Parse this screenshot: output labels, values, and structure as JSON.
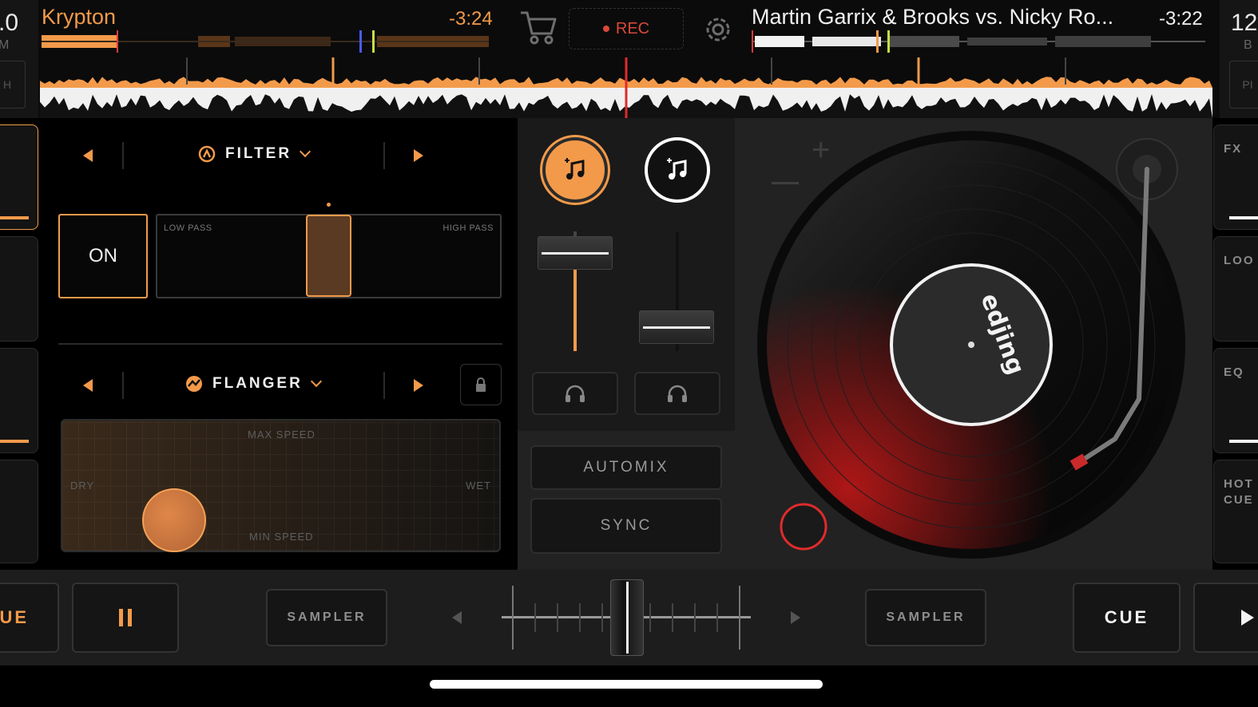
{
  "deck_a": {
    "bpm_partial": ".0",
    "bpm_unit_partial": "M",
    "edge_button_partial": "H",
    "title": "Krypton",
    "time_remaining": "-3:24"
  },
  "deck_b": {
    "bpm_partial": "12",
    "bpm_unit_partial": "B",
    "edge_button_partial": "PI",
    "title": "Martin Garrix & Brooks vs. Nicky Ro...",
    "time_remaining": "-3:22",
    "label_brand": "edjing"
  },
  "toolbar": {
    "cart_icon": "shopping-cart-icon",
    "rec_label": "REC",
    "settings_icon": "gear-icon"
  },
  "fx_panel": {
    "slot1": {
      "name": "FILTER",
      "icon": "filter-icon",
      "on_label": "ON",
      "low_label": "LOW PASS",
      "high_label": "HIGH PASS",
      "position": 0.5
    },
    "slot2": {
      "name": "FLANGER",
      "icon": "flanger-icon",
      "lock_icon": "lock-icon",
      "pad": {
        "top": "MAX SPEED",
        "bottom": "MIN SPEED",
        "left": "DRY",
        "right": "WET"
      }
    }
  },
  "mixer": {
    "automix_label": "AUTOMIX",
    "sync_label": "SYNC",
    "volume_a": 0.82,
    "volume_b": 0.2
  },
  "right_tabs": [
    "FX",
    "LOO",
    "EQ",
    "HOT CUE"
  ],
  "bottom": {
    "cue_a_partial": "UE",
    "sampler_a": "SAMPLER",
    "sampler_b": "SAMPLER",
    "cue_b": "CUE",
    "crossfader": 0.5
  },
  "colors": {
    "accent": "#f39a4a",
    "rec": "#d9483a",
    "bg": "#000000"
  }
}
